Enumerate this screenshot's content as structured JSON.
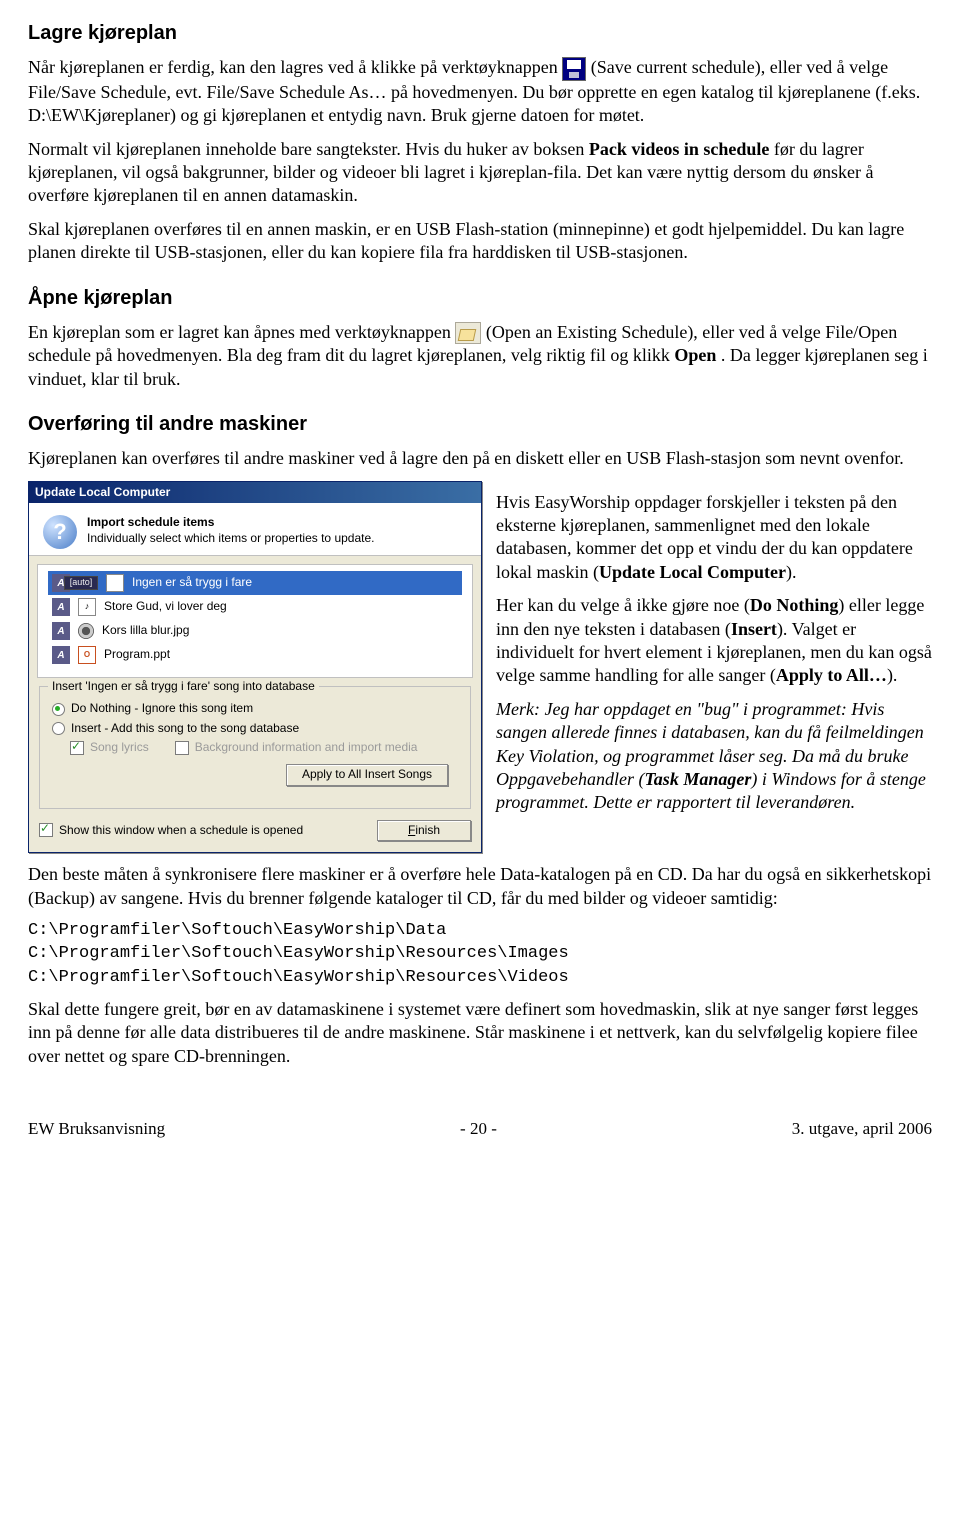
{
  "h1": "Lagre kjøreplan",
  "p1a": "Når kjøreplanen er ferdig, kan den lagres ved å klikke på verktøyknappen ",
  "p1b": " (Save current schedule), eller ved å velge File/Save Schedule, evt. File/Save Schedule As… på hovedmenyen. Du bør opprette en egen katalog til kjøreplanene (f.eks. D:\\EW\\Kjøreplaner) og gi kjøreplanen et entydig navn. Bruk gjerne datoen for møtet.",
  "p2a": "Normalt vil kjøreplanen inneholde bare sangtekster. Hvis du huker av boksen ",
  "p2bold": "Pack videos in schedule",
  "p2b": " før du lagrer kjøreplanen, vil også bakgrunner, bilder og videoer bli lagret i kjøreplan-fila. Det kan være nyttig dersom du ønsker å overføre kjøreplanen til en annen datamaskin.",
  "p3": "Skal kjøreplanen overføres til en annen maskin, er en USB Flash-station (minnepinne) et godt hjelpemiddel. Du kan lagre planen direkte til USB-stasjonen, eller du kan kopiere fila fra harddisken til USB-stasjonen.",
  "h2": "Åpne kjøreplan",
  "p4a": "En kjøreplan som er lagret kan åpnes med verktøyknappen ",
  "p4b": " (Open an Existing Schedule), eller ved å velge File/Open schedule på hovedmenyen. Bla deg fram dit du lagret kjøreplanen, velg riktig fil og klikk ",
  "p4bold": "Open",
  "p4c": ". Da legger kjøreplanen seg i vinduet, klar til bruk.",
  "h3": "Overføring til andre maskiner",
  "p5": "Kjøreplanen kan overføres til andre maskiner ved å lagre den på en diskett eller en USB Flash-stasjon som nevnt ovenfor.",
  "dlg": {
    "title": "Update Local Computer",
    "head_bold": "Import schedule items",
    "head_sub": "Individually select which items or properties to update.",
    "items": [
      {
        "label": "Ingen er så trygg i fare",
        "sel": true,
        "kind": "song"
      },
      {
        "label": "Store Gud, vi lover deg",
        "sel": false,
        "kind": "song"
      },
      {
        "label": "Kors lilla blur.jpg",
        "sel": false,
        "kind": "img"
      },
      {
        "label": "Program.ppt",
        "sel": false,
        "kind": "ppt"
      }
    ],
    "group_legend": "Insert 'Ingen er så trygg i fare' song into database",
    "radio1": "Do Nothing - Ignore this song item",
    "radio2": "Insert - Add this song to the song database",
    "chk_lyrics": "Song lyrics",
    "chk_bg": "Background information and import media",
    "btn_apply": "Apply to All Insert Songs",
    "chk_show": "Show this window when a schedule is opened",
    "btn_finish_pre": "F",
    "btn_finish_post": "inish"
  },
  "right1a": "Hvis EasyWorship oppdager forskjeller i teksten på den eksterne kjøreplanen, sammenlignet med den lokale databasen, kommer det opp et vindu der du kan oppdatere lokal maskin (",
  "right1bold": "Update Local Computer",
  "right1b": ").",
  "right2a": "Her kan du velge å ikke gjøre noe (",
  "right2b1": "Do Nothing",
  "right2c": ") eller legge inn den nye teksten i databasen (",
  "right2b2": "Insert",
  "right2d": "). Valget er individuelt for hvert element i kjøreplanen, men du kan også velge samme handling for alle sanger (",
  "right2b3": "Apply to All…",
  "right2e": ").",
  "right3a": "Merk: Jeg har oppdaget en \"bug\" i programmet: Hvis sangen allerede finnes i databasen, kan du få feilmeldingen Key Violation, og programmet låser seg. Da må du bruke Oppgavebehandler (",
  "right3bold": "Task Manager",
  "right3b": ") i Windows for å stenge programmet. Dette er rapportert til leverandøren.",
  "p6": "Den beste måten å synkronisere flere maskiner er å overføre hele Data-katalogen på en CD. Da har du også en sikkerhetskopi (Backup) av sangene. Hvis du brenner følgende kataloger til CD, får du med bilder og videoer samtidig:",
  "mono1": "C:\\Programfiler\\Softouch\\EasyWorship\\Data",
  "mono2": "C:\\Programfiler\\Softouch\\EasyWorship\\Resources\\Images",
  "mono3": "C:\\Programfiler\\Softouch\\EasyWorship\\Resources\\Videos",
  "p7": "Skal dette fungere greit, bør en av datamaskinene i systemet være definert som hovedmaskin, slik at nye sanger først legges inn på denne før alle data distribueres til de andre maskinene. Står maskinene i et nettverk, kan du selvfølgelig kopiere filee over nettet og spare CD-brenningen.",
  "footer": {
    "left": "EW Bruksanvisning",
    "center": "- 20 -",
    "right": "3. utgave, april 2006"
  }
}
